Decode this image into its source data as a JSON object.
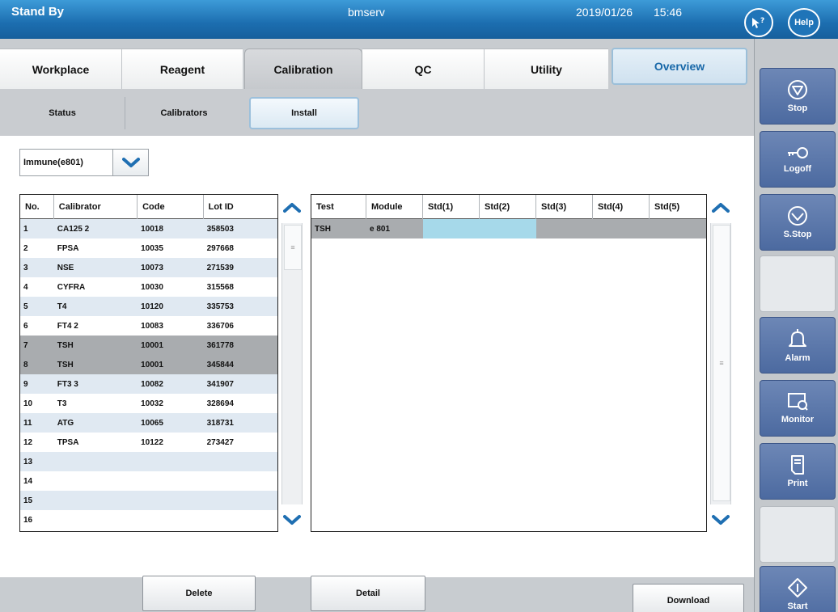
{
  "titlebar": {
    "status": "Stand By",
    "host": "bmserv",
    "date": "2019/01/26",
    "time": "15:46",
    "help_label": "Help",
    "pointer_help_label": "?"
  },
  "tabs": [
    {
      "label": "Workplace",
      "active": false
    },
    {
      "label": "Reagent",
      "active": false
    },
    {
      "label": "Calibration",
      "active": true
    },
    {
      "label": "QC",
      "active": false
    },
    {
      "label": "Utility",
      "active": false
    },
    {
      "label": "Overview",
      "active": false
    }
  ],
  "subtabs": [
    {
      "label": "Status",
      "active": false
    },
    {
      "label": "Calibrators",
      "active": false
    },
    {
      "label": "Install",
      "active": true
    }
  ],
  "dropdown": {
    "value": "Immune(e801)"
  },
  "calibrator_table": {
    "headers": [
      "No.",
      "Calibrator",
      "Code",
      "Lot ID"
    ],
    "rows": [
      {
        "no": "1",
        "calibrator": "CA125 2",
        "code": "10018",
        "lot": "358503"
      },
      {
        "no": "2",
        "calibrator": "FPSA",
        "code": "10035",
        "lot": "297668"
      },
      {
        "no": "3",
        "calibrator": "NSE",
        "code": "10073",
        "lot": "271539"
      },
      {
        "no": "4",
        "calibrator": "CYFRA",
        "code": "10030",
        "lot": "315568"
      },
      {
        "no": "5",
        "calibrator": "T4",
        "code": "10120",
        "lot": "335753"
      },
      {
        "no": "6",
        "calibrator": "FT4 2",
        "code": "10083",
        "lot": "336706"
      },
      {
        "no": "7",
        "calibrator": "TSH",
        "code": "10001",
        "lot": "361778"
      },
      {
        "no": "8",
        "calibrator": "TSH",
        "code": "10001",
        "lot": "345844"
      },
      {
        "no": "9",
        "calibrator": "FT3 3",
        "code": "10082",
        "lot": "341907"
      },
      {
        "no": "10",
        "calibrator": "T3",
        "code": "10032",
        "lot": "328694"
      },
      {
        "no": "11",
        "calibrator": "ATG",
        "code": "10065",
        "lot": "318731"
      },
      {
        "no": "12",
        "calibrator": "TPSA",
        "code": "10122",
        "lot": "273427"
      },
      {
        "no": "13",
        "calibrator": "",
        "code": "",
        "lot": ""
      },
      {
        "no": "14",
        "calibrator": "",
        "code": "",
        "lot": ""
      },
      {
        "no": "15",
        "calibrator": "",
        "code": "",
        "lot": ""
      },
      {
        "no": "16",
        "calibrator": "",
        "code": "",
        "lot": ""
      }
    ],
    "selected_rows": [
      "7",
      "8"
    ]
  },
  "test_table": {
    "headers": [
      "Test",
      "Module",
      "Std(1)",
      "Std(2)",
      "Std(3)",
      "Std(4)",
      "Std(5)"
    ],
    "rows": [
      {
        "test": "TSH",
        "module": "e 801",
        "std1": "",
        "std2": "",
        "std3": "",
        "std4": "",
        "std5": ""
      }
    ]
  },
  "buttons": {
    "delete": "Delete",
    "detail": "Detail",
    "download": "Download"
  },
  "rail": {
    "stop": "Stop",
    "logoff": "Logoff",
    "sstop": "S.Stop",
    "alarm": "Alarm",
    "monitor": "Monitor",
    "print": "Print",
    "start": "Start"
  },
  "colors": {
    "titlebar": "#1c6eb0",
    "rail_button": "#5a76aa",
    "selected_row": "#a9acaf",
    "alt_row": "#e0e9f2",
    "highlight_cell": "#a6d9ea",
    "chevron": "#1f6fb2"
  }
}
